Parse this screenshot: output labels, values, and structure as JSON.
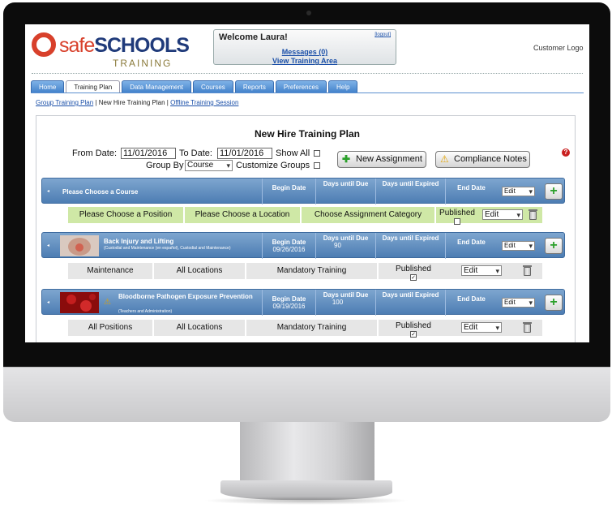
{
  "header": {
    "logo_word_a": "safe",
    "logo_word_b": "SCHOOLS",
    "logo_sub": "TRAINING",
    "welcome": "Welcome Laura!",
    "logout": "[logout]",
    "messages": "Messages (0)",
    "view_training": "View Training Area",
    "customer_logo": "Customer Logo"
  },
  "tabs": [
    {
      "label": "Home"
    },
    {
      "label": "Training Plan",
      "active": true
    },
    {
      "label": "Data Management"
    },
    {
      "label": "Courses"
    },
    {
      "label": "Reports"
    },
    {
      "label": "Preferences"
    },
    {
      "label": "Help"
    }
  ],
  "subnav": {
    "group_plan": "Group Training Plan",
    "sep1": "|",
    "new_hire": "New Hire Training Plan",
    "sep2": "|",
    "offline": "Offline Training Session"
  },
  "page": {
    "title": "New Hire Training Plan",
    "from_label": "From Date:",
    "from_value": "11/01/2016",
    "to_label": "To Date:",
    "to_value": "11/01/2016",
    "show_all": "Show All",
    "group_by": "Group By",
    "group_by_value": "Course",
    "customize": "Customize Groups",
    "new_assignment": "New Assignment",
    "compliance": "Compliance Notes",
    "help_icon": "?"
  },
  "columns": {
    "begin": "Begin Date",
    "days_due": "Days until Due",
    "days_expired": "Days until Expired",
    "end": "End Date"
  },
  "groups": [
    {
      "course": "Please Choose a Course",
      "begin": "",
      "due": "",
      "expired": "",
      "select": "Edit",
      "row": {
        "position": "Please Choose a Position",
        "location": "Please Choose a Location",
        "category": "Choose Assignment Category",
        "published": "Published",
        "edit": "Edit"
      }
    },
    {
      "course": "Back Injury and Lifting",
      "sub": "(Custodial and Maintenance (en español), Custodial and Maintenance)",
      "begin": "09/26/2016",
      "due": "90",
      "expired": "",
      "select": "Edit",
      "row": {
        "position": "Maintenance",
        "location": "All Locations",
        "category": "Mandatory Training",
        "published": "Published",
        "edit": "Edit"
      }
    },
    {
      "course": "Bloodborne Pathogen Exposure Prevention",
      "sub": "(Teachers and Administration)",
      "begin": "09/19/2016",
      "due": "100",
      "expired": "",
      "select": "Edit",
      "row": {
        "position": "All Positions",
        "location": "All Locations",
        "category": "Mandatory Training",
        "published": "Published",
        "edit": "Edit"
      }
    }
  ],
  "colors": {
    "bar": "#4d7db3",
    "green_row": "#cfe8a6",
    "logo_red": "#d8402b",
    "logo_blue": "#1f3a7a"
  }
}
